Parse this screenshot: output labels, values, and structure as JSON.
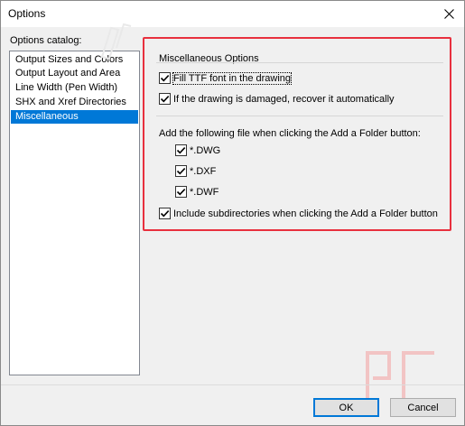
{
  "window": {
    "title": "Options"
  },
  "catalog": {
    "label": "Options catalog:",
    "items": [
      {
        "label": "Output Sizes and Colors",
        "selected": false
      },
      {
        "label": "Output Layout and Area",
        "selected": false
      },
      {
        "label": "Line Width (Pen Width)",
        "selected": false
      },
      {
        "label": "SHX and Xref Directories",
        "selected": false
      },
      {
        "label": "Miscellaneous",
        "selected": true
      }
    ]
  },
  "misc": {
    "group_title": "Miscellaneous Options",
    "fill_ttf": {
      "label": "Fill TTF font in the drawing",
      "checked": true
    },
    "recover": {
      "label": "If the drawing is damaged, recover it automatically",
      "checked": true
    },
    "add_files_note": "Add the following file when clicking the Add a Folder button:",
    "dwg": {
      "label": "*.DWG",
      "checked": true
    },
    "dxf": {
      "label": "*.DXF",
      "checked": true
    },
    "dwf": {
      "label": "*.DWF",
      "checked": true
    },
    "subdirs": {
      "label": "Include subdirectories when clicking the Add a Folder button",
      "checked": true
    }
  },
  "buttons": {
    "ok": "OK",
    "cancel": "Cancel"
  },
  "colors": {
    "selection": "#0078d7",
    "highlight_border": "#e8303e",
    "watermark": "#f2c4c4"
  },
  "icons": {
    "close": "close-icon",
    "checkmark": "checkmark-icon"
  }
}
